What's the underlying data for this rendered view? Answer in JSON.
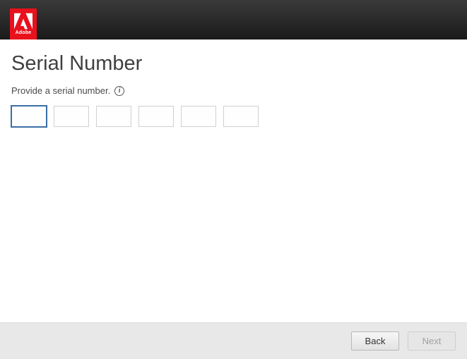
{
  "header": {
    "brand_name": "Adobe"
  },
  "main": {
    "title": "Serial Number",
    "instruction": "Provide a serial number.",
    "serial_values": [
      "",
      "",
      "",
      "",
      "",
      ""
    ]
  },
  "footer": {
    "back_label": "Back",
    "next_label": "Next"
  }
}
